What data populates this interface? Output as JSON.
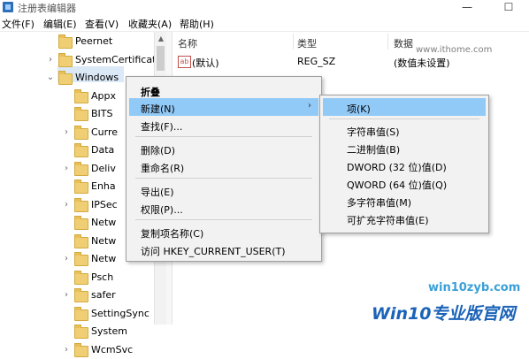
{
  "window": {
    "title": "注册表编辑器",
    "minimize_glyph": "—",
    "maximize_glyph": "☐",
    "app_icon": "regedit-icon"
  },
  "menubar": [
    "文件(F)",
    "编辑(E)",
    "查看(V)",
    "收藏夹(A)",
    "帮助(H)"
  ],
  "tree": {
    "items": [
      {
        "label": "Peernet",
        "expander": ""
      },
      {
        "label": "SystemCertificate",
        "expander": "›"
      },
      {
        "label": "Windows",
        "expander": "⌄"
      },
      {
        "label": "Appx",
        "expander": ""
      },
      {
        "label": "BITS",
        "expander": ""
      },
      {
        "label": "Curre",
        "expander": "›"
      },
      {
        "label": "Data",
        "expander": ""
      },
      {
        "label": "Deliv",
        "expander": "›"
      },
      {
        "label": "Enha",
        "expander": ""
      },
      {
        "label": "IPSec",
        "expander": "›"
      },
      {
        "label": "Netw",
        "expander": ""
      },
      {
        "label": "Netw",
        "expander": ""
      },
      {
        "label": "Netw",
        "expander": "›"
      },
      {
        "label": "Psch",
        "expander": ""
      },
      {
        "label": "safer",
        "expander": "›"
      },
      {
        "label": "SettingSync",
        "expander": ""
      },
      {
        "label": "System",
        "expander": ""
      },
      {
        "label": "WcmSvc",
        "expander": "›"
      }
    ]
  },
  "list": {
    "columns": [
      "名称",
      "类型",
      "数据"
    ],
    "rows": [
      {
        "name": "(默认)",
        "type": "REG_SZ",
        "data": "(数值未设置)",
        "icon": "ab-string-icon"
      }
    ]
  },
  "context_menu": {
    "items": [
      {
        "label": "折叠",
        "bold": true
      },
      {
        "label": "新建(N)",
        "submenu": true,
        "highlighted": true
      },
      {
        "label": "查找(F)..."
      },
      {
        "label": "删除(D)"
      },
      {
        "label": "重命名(R)"
      },
      {
        "label": "导出(E)"
      },
      {
        "label": "权限(P)..."
      },
      {
        "label": "复制项名称(C)"
      },
      {
        "label": "访问 HKEY_CURRENT_USER(T)"
      }
    ]
  },
  "submenu": {
    "items": [
      {
        "label": "项(K)",
        "highlighted": true
      },
      {
        "label": "字符串值(S)"
      },
      {
        "label": "二进制值(B)"
      },
      {
        "label": "DWORD (32 位)值(D)"
      },
      {
        "label": "QWORD (64 位)值(Q)"
      },
      {
        "label": "多字符串值(M)"
      },
      {
        "label": "可扩充字符串值(E)"
      }
    ]
  },
  "watermarks": {
    "top": "www.ithome.com",
    "site": "win10zyb.com",
    "brand": "Win10专业版官网"
  },
  "colors": {
    "highlight": "#91c9f7",
    "selected_node": "#dbe9f7",
    "menu_bg": "#f2f2f2",
    "brand": "#1b63b8"
  }
}
